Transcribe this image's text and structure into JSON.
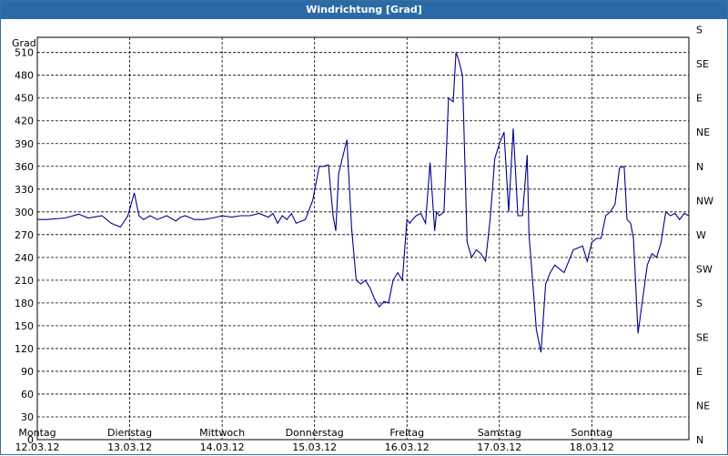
{
  "window": {
    "title": "Windrichtung [Grad]"
  },
  "chart_data": {
    "type": "line",
    "title": "Windrichtung [Grad]",
    "ylabel": "Grad",
    "ylim": [
      0,
      530
    ],
    "xlim": [
      0,
      7.05
    ],
    "y_ticks": [
      0,
      30,
      60,
      90,
      120,
      150,
      180,
      210,
      240,
      270,
      300,
      330,
      360,
      390,
      420,
      450,
      480,
      510
    ],
    "y2_ticks": [
      {
        "value": 0,
        "label": "N"
      },
      {
        "value": 45,
        "label": "NE"
      },
      {
        "value": 90,
        "label": "E"
      },
      {
        "value": 135,
        "label": "SE"
      },
      {
        "value": 180,
        "label": "S"
      },
      {
        "value": 225,
        "label": "SW"
      },
      {
        "value": 270,
        "label": "W"
      },
      {
        "value": 315,
        "label": "NW"
      },
      {
        "value": 360,
        "label": "N"
      },
      {
        "value": 405,
        "label": "NE"
      },
      {
        "value": 450,
        "label": "E"
      },
      {
        "value": 495,
        "label": "SE"
      },
      {
        "value": 540,
        "label": "S"
      }
    ],
    "x_ticks": [
      {
        "value": 0,
        "day": "Montag",
        "date": "12.03.12"
      },
      {
        "value": 1,
        "day": "Dienstag",
        "date": "13.03.12"
      },
      {
        "value": 2,
        "day": "Mittwoch",
        "date": "14.03.12"
      },
      {
        "value": 3,
        "day": "Donnerstag",
        "date": "15.03.12"
      },
      {
        "value": 4,
        "day": "Freitag",
        "date": "16.03.12"
      },
      {
        "value": 5,
        "day": "Samstag",
        "date": "17.03.12"
      },
      {
        "value": 6,
        "day": "Sonntag",
        "date": "18.03.12"
      }
    ],
    "grid": true,
    "line_color": "#00008b",
    "series": [
      {
        "x": [
          0,
          0.1,
          0.3,
          0.45,
          0.55,
          0.7,
          0.8,
          0.9,
          0.98,
          1.05,
          1.1,
          1.15,
          1.22,
          1.3,
          1.4,
          1.5,
          1.55,
          1.6,
          1.7,
          1.8,
          1.9,
          2.0,
          2.1,
          2.2,
          2.3,
          2.4,
          2.5,
          2.55,
          2.6,
          2.65,
          2.7,
          2.75,
          2.8,
          2.9,
          2.98,
          3.05,
          3.1,
          3.15,
          3.2,
          3.23,
          3.26,
          3.3,
          3.35,
          3.4,
          3.45,
          3.5,
          3.55,
          3.6,
          3.65,
          3.7,
          3.75,
          3.8,
          3.85,
          3.9,
          3.95,
          4.0,
          4.03,
          4.06,
          4.1,
          4.15,
          4.2,
          4.25,
          4.3,
          4.32,
          4.35,
          4.4,
          4.45,
          4.5,
          4.53,
          4.56,
          4.6,
          4.65,
          4.7,
          4.75,
          4.8,
          4.85,
          4.9,
          4.95,
          5.0,
          5.05,
          5.1,
          5.15,
          5.2,
          5.25,
          5.3,
          5.32,
          5.35,
          5.4,
          5.45,
          5.5,
          5.55,
          5.6,
          5.65,
          5.7,
          5.8,
          5.9,
          5.95,
          6.0,
          6.05,
          6.1,
          6.15,
          6.2,
          6.25,
          6.3,
          6.35,
          6.38,
          6.42,
          6.45,
          6.5,
          6.55,
          6.6,
          6.65,
          6.7,
          6.75,
          6.8,
          6.85,
          6.9,
          6.95,
          7.0,
          7.05
        ],
        "values": [
          290,
          290,
          292,
          297,
          292,
          295,
          285,
          280,
          295,
          325,
          295,
          290,
          295,
          290,
          295,
          288,
          293,
          295,
          290,
          290,
          292,
          295,
          293,
          295,
          295,
          298,
          293,
          298,
          285,
          295,
          290,
          298,
          285,
          290,
          315,
          360,
          360,
          362,
          295,
          275,
          350,
          370,
          395,
          280,
          210,
          205,
          210,
          200,
          185,
          175,
          182,
          180,
          210,
          220,
          210,
          290,
          285,
          290,
          295,
          298,
          285,
          365,
          275,
          300,
          295,
          300,
          450,
          445,
          510,
          500,
          480,
          260,
          240,
          250,
          245,
          235,
          290,
          370,
          390,
          405,
          300,
          410,
          295,
          295,
          375,
          270,
          225,
          145,
          115,
          205,
          220,
          230,
          225,
          220,
          250,
          255,
          235,
          260,
          265,
          265,
          295,
          300,
          310,
          358,
          360,
          290,
          285,
          265,
          140,
          185,
          230,
          245,
          240,
          260,
          300,
          295,
          298,
          290,
          298,
          295
        ]
      }
    ]
  }
}
